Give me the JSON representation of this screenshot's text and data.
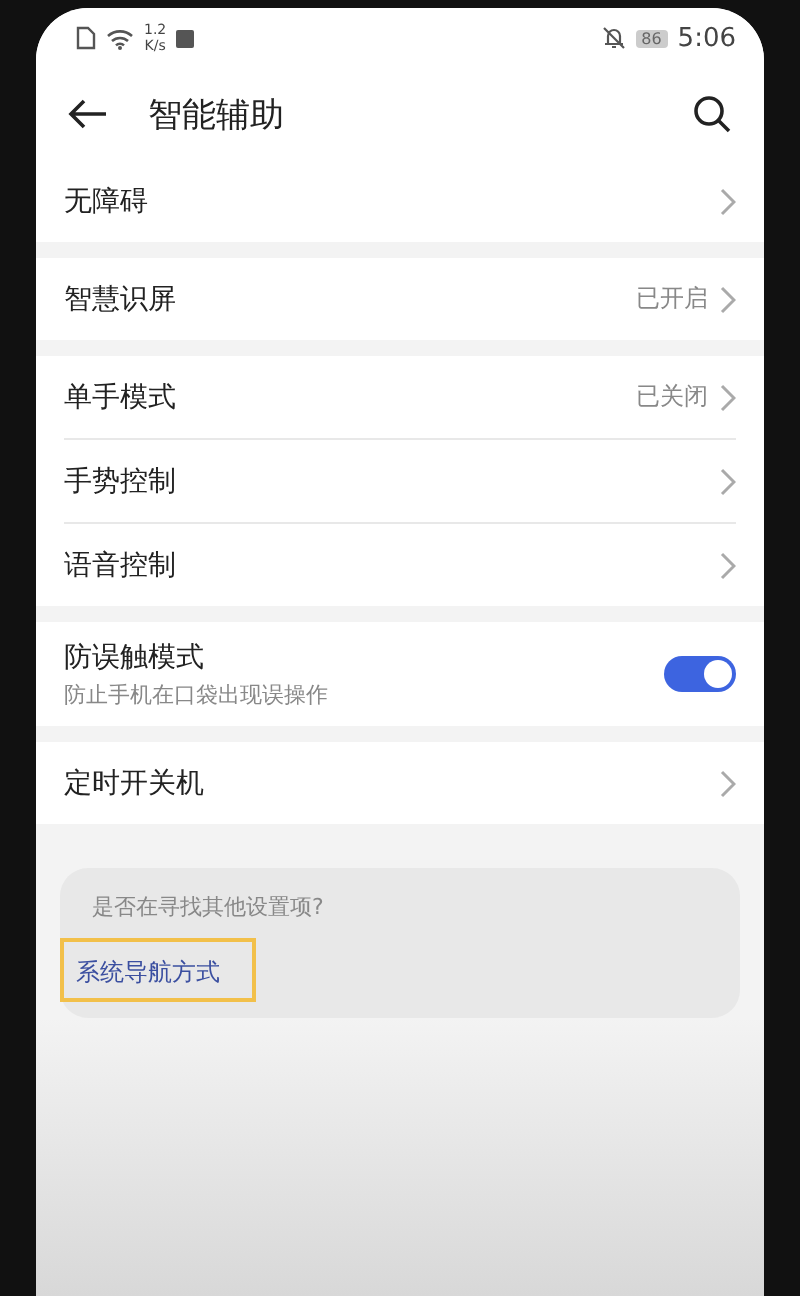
{
  "status_bar": {
    "net_speed_value": "1.2",
    "net_speed_unit": "K/s",
    "battery": "86",
    "time": "5:06"
  },
  "header": {
    "title": "智能辅助"
  },
  "groups": [
    {
      "items": [
        {
          "kind": "link",
          "label": "无障碍"
        }
      ]
    },
    {
      "items": [
        {
          "kind": "link",
          "label": "智慧识屏",
          "value": "已开启"
        }
      ]
    },
    {
      "items": [
        {
          "kind": "link",
          "label": "单手模式",
          "value": "已关闭"
        },
        {
          "kind": "link",
          "label": "手势控制"
        },
        {
          "kind": "link",
          "label": "语音控制"
        }
      ]
    },
    {
      "items": [
        {
          "kind": "switch",
          "label": "防误触模式",
          "subtitle": "防止手机在口袋出现误操作",
          "on": true
        }
      ]
    },
    {
      "items": [
        {
          "kind": "link",
          "label": "定时开关机"
        }
      ]
    }
  ],
  "suggestion": {
    "question": "是否在寻找其他设置项?",
    "link": "系统导航方式",
    "highlighted": true
  }
}
